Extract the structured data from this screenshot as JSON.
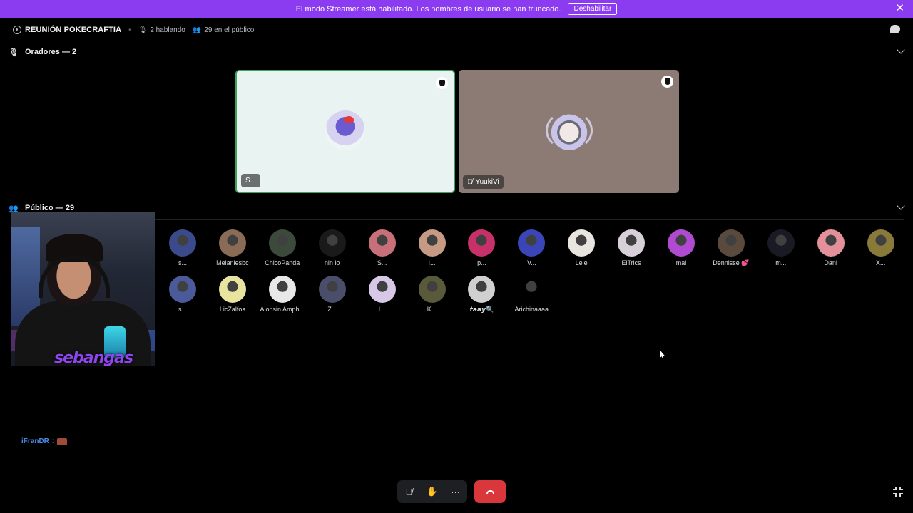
{
  "banner": {
    "text": "El modo Streamer está habilitado. Los nombres de usuario se han truncado.",
    "button": "Deshabilitar",
    "close": "✕"
  },
  "header": {
    "title": "REUNIÓN POKECRAFTIA",
    "speaking": "2 hablando",
    "audience_count": "29 en el público"
  },
  "speakers": {
    "heading": "Oradores — 2",
    "tiles": [
      {
        "name": "S...",
        "muted": false
      },
      {
        "name": "YuukiVi",
        "muted": true
      }
    ]
  },
  "audience": {
    "heading": "Público — 29",
    "members": [
      {
        "name": "s...",
        "color": "#3a4a8a"
      },
      {
        "name": "Melaniesbc",
        "color": "#8a6b55"
      },
      {
        "name": "ChicoPanda",
        "color": "#3c4a3c"
      },
      {
        "name": "nin io",
        "color": "#1a1a1a"
      },
      {
        "name": "S...",
        "color": "#c8707a"
      },
      {
        "name": "I...",
        "color": "#c79a83"
      },
      {
        "name": "p...",
        "color": "#c8306a"
      },
      {
        "name": "V...",
        "color": "#3a46b8"
      },
      {
        "name": "Lele",
        "color": "#e8e4e0"
      },
      {
        "name": "ElTrics",
        "color": "#d8d0d8"
      },
      {
        "name": "mai",
        "color": "#b04ad0"
      },
      {
        "name": "Dennisse 💕",
        "color": "#5a4a3e"
      },
      {
        "name": "m...",
        "color": "#1a1a24"
      },
      {
        "name": "Dani",
        "color": "#e4909a"
      },
      {
        "name": "X...",
        "color": "#8a7a3a"
      },
      {
        "name": "s...",
        "color": "#4a5a9a"
      },
      {
        "name": "LicZalfos",
        "color": "#e8e4a0"
      },
      {
        "name": "Alonsin Amph...",
        "color": "#e8e8e8"
      },
      {
        "name": "Z...",
        "color": "#4a4e6a"
      },
      {
        "name": "I...",
        "color": "#d8c8e8"
      },
      {
        "name": "K...",
        "color": "#5a5a3a"
      },
      {
        "name": "𝙩𝙖𝙖𝙮🔍",
        "color": "#d0d0d0"
      },
      {
        "name": "Arichinaaaa",
        "color": "#000000"
      }
    ]
  },
  "webcam": {
    "logo": "sebangas"
  },
  "chat": {
    "user": "iFranDR",
    "colon": ":"
  },
  "controls": {
    "more": "···"
  },
  "colors": {
    "banner": "#8c3cf0",
    "speaking_ring": "#3ba55c",
    "leave": "#da373c",
    "chat_user": "#4a8de8"
  }
}
